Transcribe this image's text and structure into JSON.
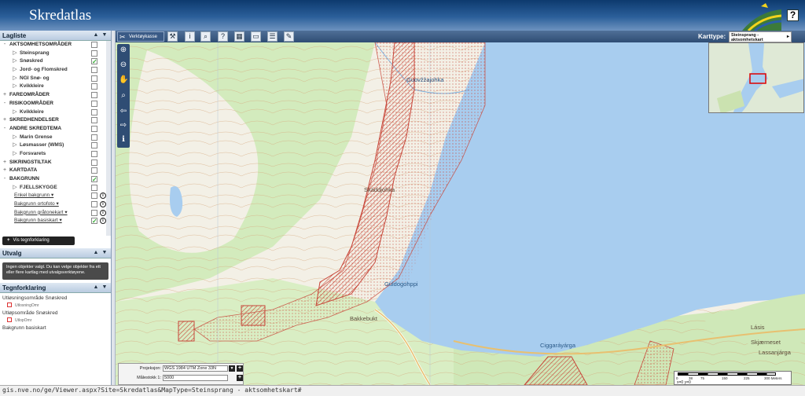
{
  "header": {
    "title": "Skredatlas",
    "help": "?"
  },
  "layers": {
    "title": "Lagliste",
    "items": [
      {
        "label": "AKTSOMHETSOMRÅDER",
        "level": 0,
        "expand": "-",
        "checked": false,
        "info": false
      },
      {
        "label": "Steinsprang",
        "level": 1,
        "expand": "▷",
        "checked": false,
        "info": false
      },
      {
        "label": "Snøskred",
        "level": 1,
        "expand": "▷",
        "checked": true,
        "info": false
      },
      {
        "label": "Jord- og Flomskred",
        "level": 1,
        "expand": "▷",
        "checked": false,
        "info": false
      },
      {
        "label": "NGI Snø- og",
        "level": 1,
        "expand": "▷",
        "checked": false,
        "info": false
      },
      {
        "label": "Kvikkleire",
        "level": 1,
        "expand": "▷",
        "checked": false,
        "info": false
      },
      {
        "label": "FAREOMRÅDER",
        "level": 0,
        "expand": "+",
        "checked": false,
        "info": false
      },
      {
        "label": "RISIKOOMRÅDER",
        "level": 0,
        "expand": "-",
        "checked": false,
        "info": false
      },
      {
        "label": "Kvikkleire",
        "level": 1,
        "expand": "▷",
        "checked": false,
        "info": false
      },
      {
        "label": "SKREDHENDELSER",
        "level": 0,
        "expand": "+",
        "checked": false,
        "info": false
      },
      {
        "label": "ANDRE SKREDTEMA",
        "level": 0,
        "expand": "-",
        "checked": false,
        "info": false
      },
      {
        "label": "Marin Grense",
        "level": 1,
        "expand": "▷",
        "checked": false,
        "info": false
      },
      {
        "label": "Løsmasser (WMS)",
        "level": 1,
        "expand": "▷",
        "checked": false,
        "info": false
      },
      {
        "label": "Forsvarets",
        "level": 1,
        "expand": "▷",
        "checked": false,
        "info": false
      },
      {
        "label": "SIKRINGSTILTAK",
        "level": 0,
        "expand": "+",
        "checked": false,
        "info": false
      },
      {
        "label": "KARTDATA",
        "level": 0,
        "expand": "+",
        "checked": false,
        "info": false
      },
      {
        "label": "BAKGRUNN",
        "level": 0,
        "expand": "-",
        "checked": true,
        "info": false
      },
      {
        "label": "FJELLSKYGGE",
        "level": 1,
        "expand": "▷",
        "checked": false,
        "info": false
      },
      {
        "label": "Enkel bakgrunn ▾",
        "level": 1,
        "expand": "",
        "checked": false,
        "info": true,
        "link": true
      },
      {
        "label": "Bakgrunn ortofoto ▾",
        "level": 1,
        "expand": "",
        "checked": false,
        "info": true,
        "link": true
      },
      {
        "label": "Bakgrunn gråtonekart ▾",
        "level": 1,
        "expand": "",
        "checked": false,
        "info": true,
        "link": true
      },
      {
        "label": "Bakgrunn basiskart ▾",
        "level": 1,
        "expand": "",
        "checked": true,
        "info": true,
        "link": true
      }
    ],
    "legend_button": "Vis tegnforklaring"
  },
  "utvalg": {
    "title": "Utvalg",
    "message": "Ingen objekter valgt. Du kan velge objekter fra ett eller flere kartlag med utvalgsverktøyene."
  },
  "tegnforklaring": {
    "title": "Tegnforklaring",
    "groups": [
      {
        "heading": "Utløsningsområde Snøskred",
        "item": "UtlosningOmr"
      },
      {
        "heading": "Utløpsområde Snøskred",
        "item": "UtlopOmr"
      }
    ],
    "footer": "Bakgrunn basiskart"
  },
  "toolbar": {
    "main_tool": "Verktøykasse",
    "karttype_label": "Karttype:",
    "karttype_value": "Steinsprang - aktsomhetskart"
  },
  "map": {
    "places": [
      {
        "name": "Guovžžajohka",
        "type": "water"
      },
      {
        "name": "Skáddjohka",
        "type": "land"
      },
      {
        "name": "Guldogohppi",
        "type": "water"
      },
      {
        "name": "Bakkebukt",
        "type": "land"
      },
      {
        "name": "Ciggaráyárga",
        "type": "water"
      },
      {
        "name": "Lásis",
        "type": "land"
      },
      {
        "name": "Skjærneset",
        "type": "land"
      },
      {
        "name": "Lassanjárga",
        "type": "land"
      }
    ]
  },
  "projection": {
    "label": "Projeksjon:",
    "value": "WGS 1984 UTM Zone 33N",
    "scale_label": "Målestokk 1:",
    "scale_value": "5000"
  },
  "scalebar": {
    "ticks": [
      "0",
      "38",
      "75",
      "150",
      "225",
      "300 Meters"
    ],
    "coords": "x=0 y=0"
  },
  "status": {
    "url": "gis.nve.no/ge/Viewer.aspx?Site=Skredatlas&MapType=Steinsprang - aktsomhetskart#"
  },
  "colors": {
    "header": "#0d3a6e",
    "water": "#a8cdef",
    "hazard": "#d93a2c",
    "forest": "#cde7b6",
    "open_land": "#f3f0e6"
  }
}
